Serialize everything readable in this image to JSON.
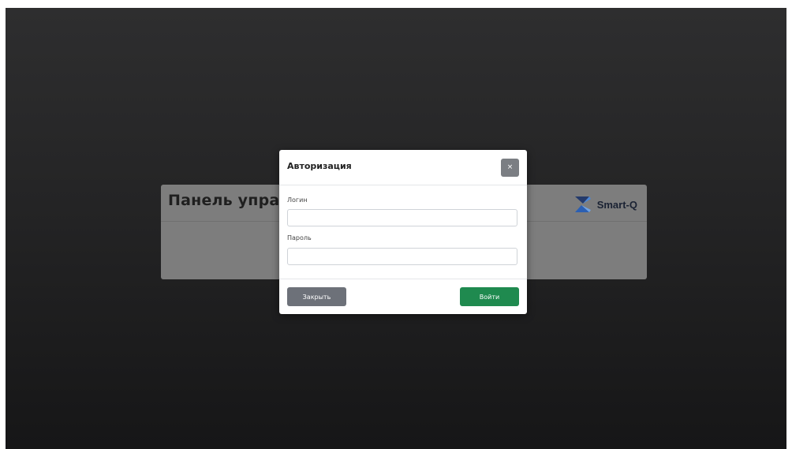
{
  "panel": {
    "title": "Панель управления",
    "logo_text": "Smart-Q",
    "logo_icon": "hourglass-logo-icon"
  },
  "modal": {
    "title": "Авторизация",
    "close_glyph": "×",
    "login_label": "Логин",
    "login_value": "",
    "login_placeholder": "",
    "password_label": "Пароль",
    "password_value": "",
    "password_placeholder": "",
    "close_button": "Закрыть",
    "submit_button": "Войти"
  },
  "colors": {
    "submit": "#1f8a4f",
    "secondary": "#6d7179"
  }
}
